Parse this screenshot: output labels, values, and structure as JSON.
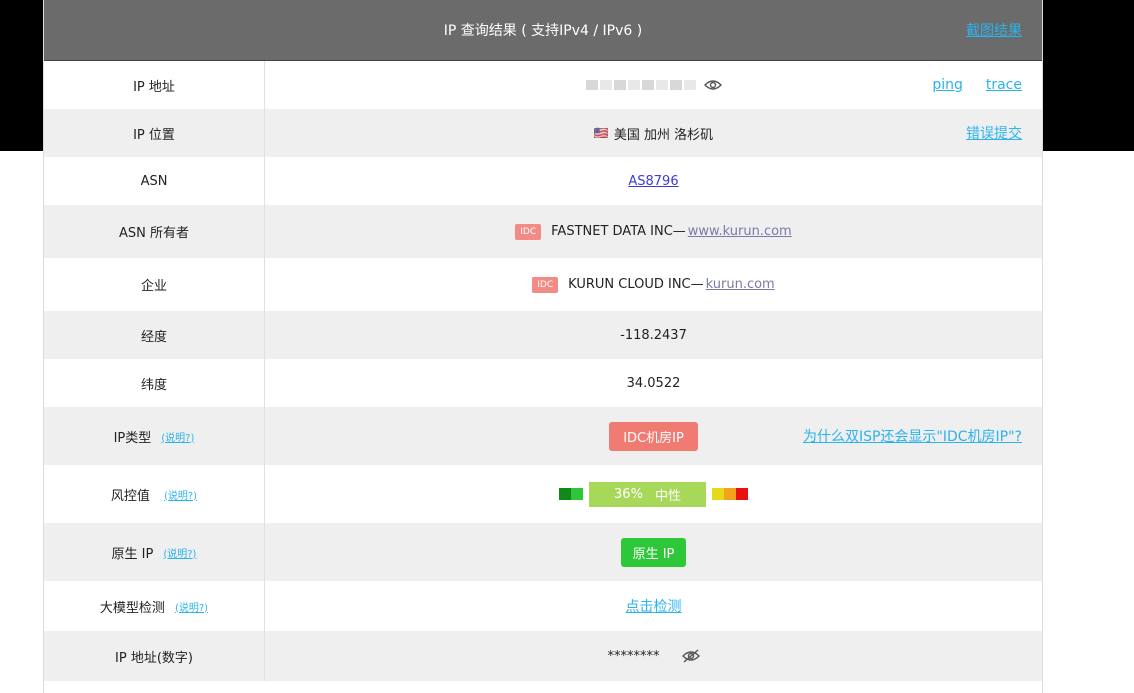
{
  "header": {
    "title": "IP 查询结果 ( 支持IPv4 / IPv6 )",
    "screenshot_link": "截图结果"
  },
  "rows": {
    "ip_address": {
      "label": "IP 地址",
      "ping": "ping",
      "trace": "trace"
    },
    "ip_location": {
      "label": "IP 位置",
      "flag": "🇺🇸",
      "value": "美国 加州 洛杉矶",
      "report_error": "错误提交"
    },
    "asn": {
      "label": "ASN",
      "value": "AS8796"
    },
    "asn_owner": {
      "label": "ASN 所有者",
      "tag": "IDC",
      "name": "FASTNET DATA INC—",
      "domain": "www.kurun.com"
    },
    "enterprise": {
      "label": "企业",
      "tag": "IDC",
      "name": "KURUN CLOUD INC—",
      "domain": "kurun.com"
    },
    "longitude": {
      "label": "经度",
      "value": "-118.2437"
    },
    "latitude": {
      "label": "纬度",
      "value": "34.0522"
    },
    "ip_type": {
      "label": "IP类型",
      "hint": "(说明?)",
      "value": "IDC机房IP",
      "why_link": "为什么双ISP还会显示\"IDC机房IP\"?"
    },
    "risk": {
      "label": "风控值",
      "hint": "(说明?)",
      "percent": "36%",
      "level": "中性",
      "score": 0.36
    },
    "native_ip": {
      "label": "原生 IP",
      "hint": "(说明?)",
      "value": "原生 IP"
    },
    "llm_check": {
      "label": "大模型检测",
      "hint": "(说明?)",
      "value": "点击检测"
    },
    "ip_numeric": {
      "label": "IP 地址(数字)",
      "value": "********"
    }
  },
  "colors": {
    "header_bg": "#6b6b6b",
    "link": "#2bb3ec",
    "idc_red": "#f07b73",
    "native_green": "#2fc73a",
    "risk_meter": "#a8d85a"
  }
}
